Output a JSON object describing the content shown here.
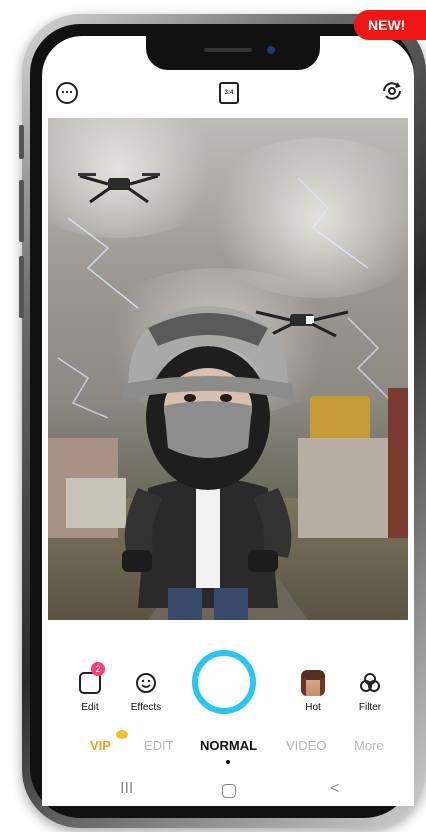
{
  "badge": {
    "new_label": "NEW!"
  },
  "topbar": {
    "more_icon": "more-dots-icon",
    "ratio_label": "3:4",
    "flip_icon": "camera-flip-icon"
  },
  "controls": {
    "edit": {
      "label": "Edit",
      "badge_count": "2"
    },
    "effects": {
      "label": "Effects"
    },
    "hot": {
      "label": "Hot"
    },
    "filter": {
      "label": "Filter"
    }
  },
  "modes": {
    "vip": "VIP",
    "edit": "EDIT",
    "normal": "NORMAL",
    "video": "VIDEO",
    "more": "More",
    "active": "NORMAL"
  },
  "navbar": {
    "recents_glyph": "III",
    "back_glyph": "<"
  },
  "colors": {
    "shutter_ring": "#29c6f0",
    "new_badge": "#f01616",
    "vip": "#e9a21c",
    "badge_count": "#ff3d6e"
  }
}
